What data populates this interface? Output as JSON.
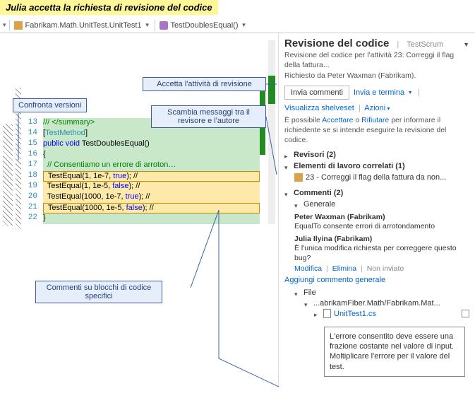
{
  "banner": "Julia accetta la richiesta di revisione del codice",
  "tabs": {
    "file": "Fabrikam.Math.UnitTest.UnitTest1",
    "method": "TestDoublesEqual()"
  },
  "callouts": {
    "compare": "Confronta versioni",
    "accept": "Accetta l'attività di revisione",
    "exchange": "Scambia messaggi tra il revisore e l'autore",
    "comments": "Commenti su blocchi di codice specifici"
  },
  "code": {
    "lines": [
      "13",
      "14",
      "15",
      "16",
      "17",
      "18",
      "19",
      "20",
      "21",
      "22"
    ],
    "l13": "/// </summary>",
    "l14a": "[",
    "l14b": "TestMethod",
    "l14c": "]",
    "l15a": "public",
    "l15b": " void",
    "l15c": " TestDoublesEqual()",
    "l16": "{",
    "l17": "  // Consentiamo un errore di arroton…",
    "l18a": "  TestEqual(1, 1e-7, ",
    "l18b": "true",
    "l18c": "); //",
    "l19a": "  TestEqual(1, 1e-5, ",
    "l19b": "false",
    "l19c": "); //",
    "l20a": "  TestEqual(1000, 1e-7, ",
    "l20b": "true",
    "l20c": "); //",
    "l21a": "  TestEqual(1000, 1e-5, ",
    "l21b": "false",
    "l21c": ");",
    "l21d": " //",
    "l22": "}"
  },
  "panel": {
    "title": "Revisione del codice",
    "project": "TestScrum",
    "desc": "Revisione del codice per l'attività 23: Correggi il flag della fattura...",
    "requested": "Richiesto da Peter Waxman (Fabrikam).",
    "btn_send": "Invia commenti",
    "link_send_finish": "Invia e termina",
    "link_shelveset": "Visualizza shelveset",
    "link_actions": "Azioni",
    "info_a": "È possibile ",
    "info_accept": "Accettare",
    "info_b": " o ",
    "info_decline": "Rifiutare",
    "info_c": " per informare il richiedente se si intende eseguire la revisione del codice.",
    "reviewers": "Revisori (2)",
    "related": "Elementi di lavoro correlati (1)",
    "workitem": "23 - Correggi il flag della fattura da non...",
    "comments_hdr": "Commenti (2)",
    "general": "Generale",
    "c1_author": "Peter Waxman (Fabrikam)",
    "c1_text": "EqualTo consente errori di arrotondamento",
    "c2_author": "Julia Ilyina (Fabrikam)",
    "c2_text": "È l'unica modifica richiesta per correggere questo bug?",
    "act_edit": "Modifica",
    "act_delete": "Elimina",
    "act_unsent": "Non inviato",
    "add_general": "Aggiungi commento generale",
    "file_hdr": "File",
    "folder": "...abrikamFiber.Math/Fabrikam.Mat...",
    "file": "UnitTest1.cs"
  },
  "tooltip": "L'errore consentito deve essere una frazione costante nel valore di input. Moltiplicare l'errore per il valore del test."
}
